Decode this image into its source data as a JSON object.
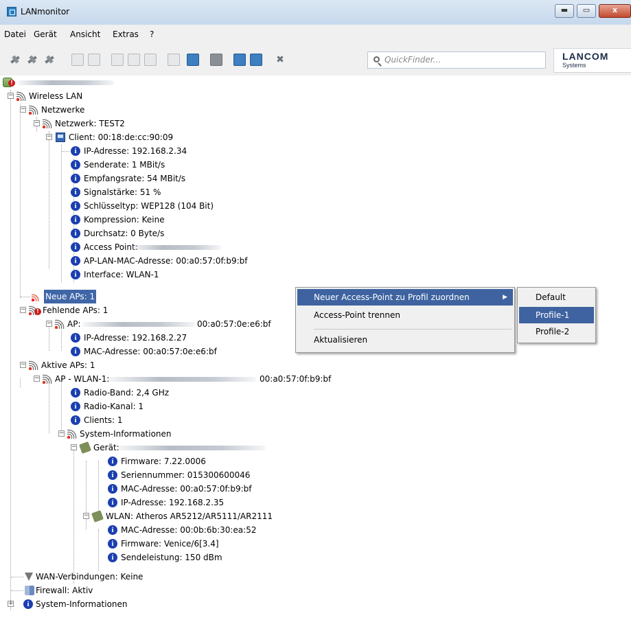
{
  "window": {
    "title": "LANmonitor",
    "min_glyph": "▬",
    "max_glyph": "▭",
    "close_glyph": "x"
  },
  "menu": [
    "Datei",
    "Gerät",
    "Ansicht",
    "Extras",
    "?"
  ],
  "toolbar": {
    "search_placeholder": "QuickFinder...",
    "logo_main": "LANCOM",
    "logo_sub": "Systems"
  },
  "tree": {
    "wireless_lan": "Wireless LAN",
    "netzwerke": "Netzwerke",
    "netzwerk": "Netzwerk: TEST2",
    "client": "Client: 00:18:de:cc:90:09",
    "client_items": [
      "IP-Adresse: 192.168.2.34",
      "Senderate: 1 MBit/s",
      "Empfangsrate: 54 MBit/s",
      "Signalstärke: 51 %",
      "Schlüsseltyp: WEP128 (104 Bit)",
      "Kompression: Keine",
      "Durchsatz: 0 Byte/s",
      "Access Point:",
      "AP-LAN-MAC-Adresse: 00:a0:57:0f:b9:bf",
      "Interface: WLAN-1"
    ],
    "neue_aps": "Neue APs: 1",
    "fehlende_aps": "Fehlende APs: 1",
    "fehlende_ap": "AP:",
    "fehlende_ap_mac": "00:a0:57:0e:e6:bf",
    "fehlende_items": [
      "IP-Adresse: 192.168.2.27",
      "MAC-Adresse: 00:a0:57:0e:e6:bf"
    ],
    "aktive_aps": "Aktive APs: 1",
    "aktive_ap": "AP - WLAN-1:",
    "aktive_ap_mac": "00:a0:57:0f:b9:bf",
    "aktive_items": [
      "Radio-Band: 2,4 GHz",
      "Radio-Kanal: 1",
      "Clients: 1"
    ],
    "sysinfo": "System-Informationen",
    "geraet": "Gerät:",
    "geraet_items": [
      "Firmware: 7.22.0006",
      "Seriennummer: 015300600046",
      "MAC-Adresse: 00:a0:57:0f:b9:bf",
      "IP-Adresse: 192.168.2.35"
    ],
    "wlan": "WLAN: Atheros AR5212/AR5111/AR2111",
    "wlan_items": [
      "MAC-Adresse: 00:0b:6b:30:ea:52",
      "Firmware: Venice/6[3.4]",
      "Sendeleistung: 150 dBm"
    ],
    "wan": "WAN-Verbindungen: Keine",
    "firewall": "Firewall: Aktiv",
    "sysinfo_root": "System-Informationen"
  },
  "context_menu": {
    "items": [
      "Neuer Access-Point zu Profil zuordnen",
      "Access-Point trennen",
      "Aktualisieren"
    ],
    "submenu_arrow": "▶",
    "submenu": [
      "Default",
      "Profile-1",
      "Profile-2"
    ]
  }
}
